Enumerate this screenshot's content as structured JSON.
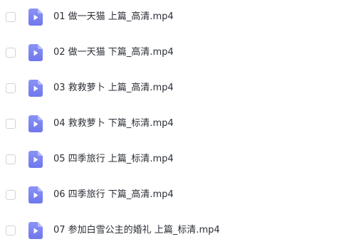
{
  "icons": {
    "video_file": "video-file-icon",
    "checkbox": "checkbox-icon"
  },
  "colors": {
    "video_icon_top": "#8b93f6",
    "video_icon_bottom": "#6f77ec",
    "text": "#2b2f36",
    "checkbox_border": "#d0d3d9"
  },
  "files": [
    {
      "name": "01 做一天猫 上篇_高清.mp4",
      "checked": false
    },
    {
      "name": "02 做一天猫 下篇_高清.mp4",
      "checked": false
    },
    {
      "name": "03 救救萝卜 上篇_高清.mp4",
      "checked": false
    },
    {
      "name": "04 救救萝卜 下篇_标清.mp4",
      "checked": false
    },
    {
      "name": "05 四季旅行 上篇_标清.mp4",
      "checked": false
    },
    {
      "name": "06 四季旅行 下篇_高清.mp4",
      "checked": false
    },
    {
      "name": "07 参加白雪公主的婚礼 上篇_标清.mp4",
      "checked": false
    }
  ]
}
